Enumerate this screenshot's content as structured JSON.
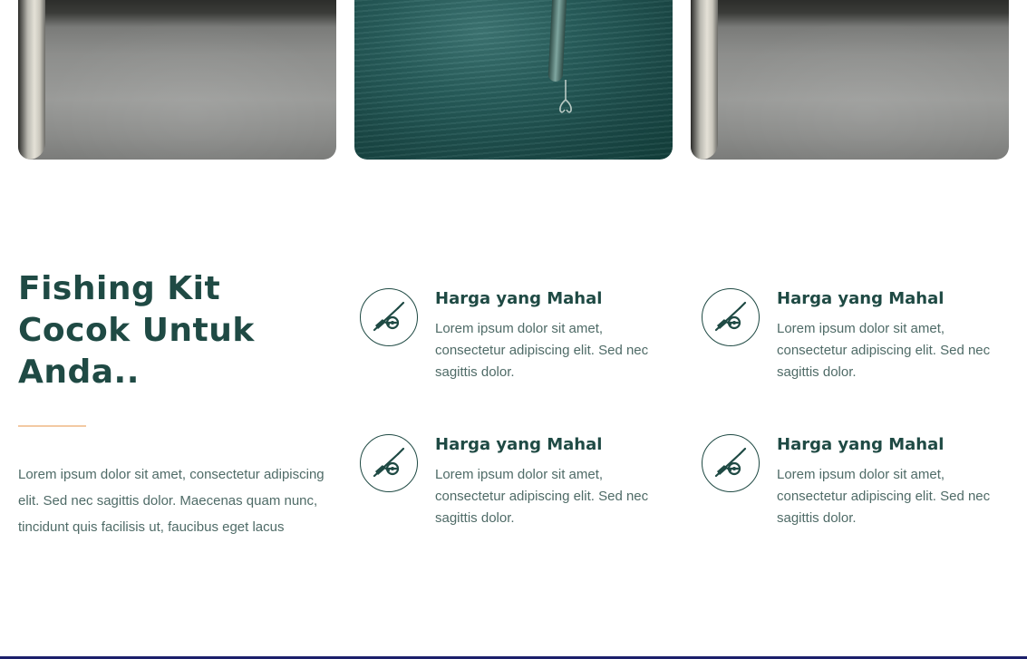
{
  "images": [
    {
      "name": "hands-gray-photo"
    },
    {
      "name": "sea-lure-photo"
    },
    {
      "name": "hands-gray-photo"
    }
  ],
  "intro": {
    "heading": "Fishing Kit\nCocok Untuk\nAnda..",
    "text": "Lorem ipsum dolor sit amet, consectetur adipiscing elit. Sed nec sagittis dolor. Maecenas quam nunc, tincidunt quis facilisis ut, faucibus eget lacus"
  },
  "features": [
    {
      "icon": "fishing-rod-icon",
      "title": "Harga yang Mahal",
      "desc": "Lorem ipsum dolor sit amet, consectetur adipiscing elit. Sed nec sagittis dolor."
    },
    {
      "icon": "fishing-rod-icon",
      "title": "Harga yang Mahal",
      "desc": "Lorem ipsum dolor sit amet, consectetur adipiscing elit. Sed nec sagittis dolor."
    },
    {
      "icon": "fishing-rod-icon",
      "title": "Harga yang Mahal",
      "desc": "Lorem ipsum dolor sit amet, consectetur adipiscing elit. Sed nec sagittis dolor."
    },
    {
      "icon": "fishing-rod-icon",
      "title": "Harga yang Mahal",
      "desc": "Lorem ipsum dolor sit amet, consectetur adipiscing elit. Sed nec sagittis dolor."
    }
  ],
  "colors": {
    "primary": "#1f4a44",
    "text": "#4f6b67",
    "accent": "#f3c9a2",
    "footer_line": "#1b1f6b"
  }
}
